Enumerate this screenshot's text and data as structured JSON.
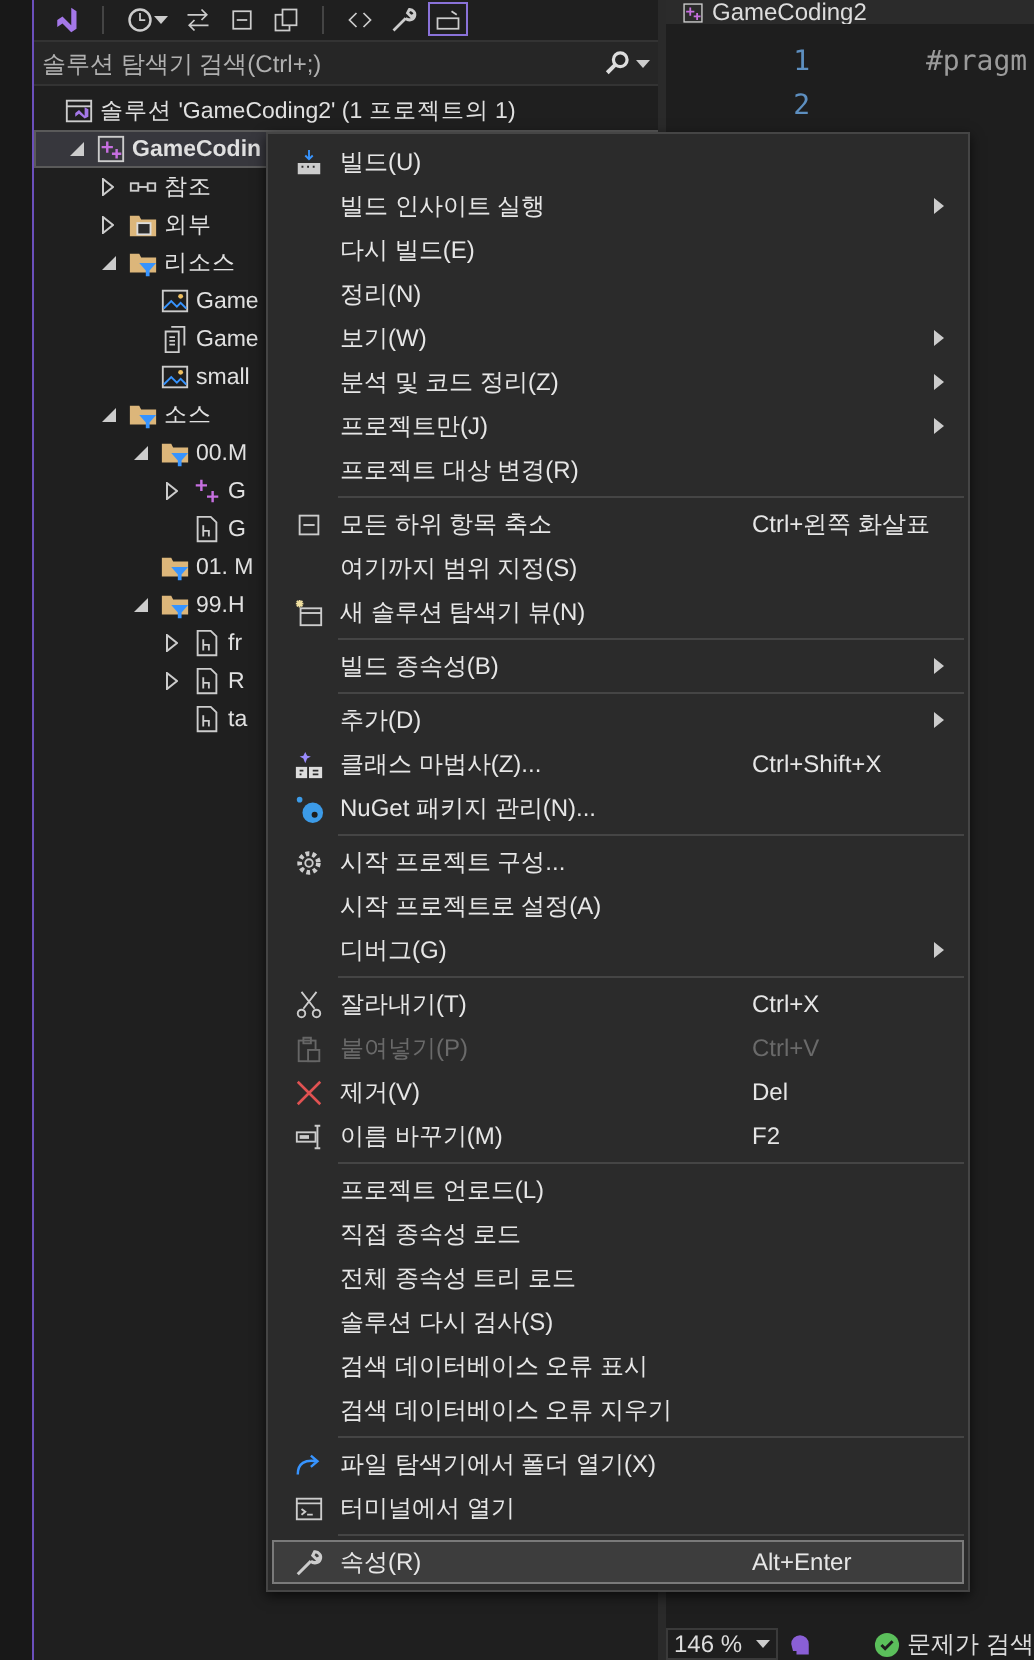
{
  "toolbar": {
    "buttons": [
      {
        "kind": "vs",
        "active": false
      },
      {
        "kind": "history",
        "active": false
      },
      {
        "kind": "sync",
        "active": false
      },
      {
        "kind": "collapse",
        "active": false
      },
      {
        "kind": "copy",
        "active": false
      },
      {
        "kind": "code",
        "active": false
      },
      {
        "kind": "wrench",
        "active": false
      },
      {
        "kind": "preview",
        "active": true
      }
    ]
  },
  "search": {
    "placeholder": "솔루션 탐색기 검색(Ctrl+;)"
  },
  "tree": {
    "label": "솔루션 'GameCoding2' (1 프로젝트의 1)",
    "kind": "solution",
    "selected": false,
    "children": [
      {
        "label": "GameCodin",
        "kind": "project",
        "selected": true,
        "expanded": true,
        "children": [
          {
            "label": "참조",
            "kind": "reference",
            "selected": false,
            "expanded": false
          },
          {
            "label": "외부",
            "kind": "external",
            "selected": false,
            "expanded": false
          },
          {
            "label": "리소스",
            "kind": "filter",
            "selected": false,
            "expanded": true,
            "children": [
              {
                "label": "Game",
                "kind": "image",
                "selected": false
              },
              {
                "label": "Game",
                "kind": "document",
                "selected": false
              },
              {
                "label": "small",
                "kind": "image",
                "selected": false
              }
            ]
          },
          {
            "label": "소스",
            "kind": "filter",
            "selected": false,
            "expanded": true,
            "children": [
              {
                "label": "00.M",
                "kind": "filter",
                "selected": false,
                "expanded": true,
                "children": [
                  {
                    "label": "G",
                    "kind": "cpp",
                    "selected": false,
                    "expanded": false
                  },
                  {
                    "label": "G",
                    "kind": "header",
                    "selected": false
                  }
                ]
              },
              {
                "label": "01. M",
                "kind": "filter",
                "selected": false
              },
              {
                "label": "99.H",
                "kind": "filter",
                "selected": false,
                "expanded": true,
                "children": [
                  {
                    "label": "fr",
                    "kind": "header",
                    "selected": false,
                    "expanded": false
                  },
                  {
                    "label": "R",
                    "kind": "header",
                    "selected": false,
                    "expanded": false
                  },
                  {
                    "label": "ta",
                    "kind": "header",
                    "selected": false
                  }
                ]
              }
            ]
          }
        ]
      }
    ]
  },
  "editor": {
    "tab": "GameCoding2",
    "lines": [
      {
        "number": "1",
        "code": "#pragm"
      },
      {
        "number": "2"
      }
    ]
  },
  "status_bar": {
    "zoom": "146 %",
    "problems": "문제가 검색"
  },
  "menu": {
    "groups": [
      [
        {
          "label": "빌드(U)",
          "kind": "build",
          "submenu": false,
          "disabled": false,
          "highlighted": false
        },
        {
          "label": "빌드 인사이트 실행",
          "submenu": true,
          "disabled": false,
          "highlighted": false
        },
        {
          "label": "다시 빌드(E)",
          "submenu": false,
          "disabled": false,
          "highlighted": false
        },
        {
          "label": "정리(N)",
          "submenu": false,
          "disabled": false,
          "highlighted": false
        },
        {
          "label": "보기(W)",
          "submenu": true,
          "disabled": false,
          "highlighted": false
        },
        {
          "label": "분석 및 코드 정리(Z)",
          "submenu": true,
          "disabled": false,
          "highlighted": false
        },
        {
          "label": "프로젝트만(J)",
          "submenu": true,
          "disabled": false,
          "highlighted": false
        },
        {
          "label": "프로젝트 대상 변경(R)",
          "submenu": false,
          "disabled": false,
          "highlighted": false
        }
      ],
      [
        {
          "label": "모든 하위 항목 축소",
          "kind": "collapse",
          "shortcut": "Ctrl+왼쪽 화살표",
          "submenu": false,
          "disabled": false,
          "highlighted": false
        },
        {
          "label": "여기까지 범위 지정(S)",
          "submenu": false,
          "disabled": false,
          "highlighted": false
        },
        {
          "label": "새 솔루션 탐색기 뷰(N)",
          "kind": "newview",
          "submenu": false,
          "disabled": false,
          "highlighted": false
        }
      ],
      [
        {
          "label": "빌드 종속성(B)",
          "submenu": true,
          "disabled": false,
          "highlighted": false
        }
      ],
      [
        {
          "label": "추가(D)",
          "submenu": true,
          "disabled": false,
          "highlighted": false
        },
        {
          "label": "클래스 마법사(Z)...",
          "kind": "classwizard",
          "shortcut": "Ctrl+Shift+X",
          "submenu": false,
          "disabled": false,
          "highlighted": false
        },
        {
          "label": "NuGet 패키지 관리(N)...",
          "kind": "nuget",
          "submenu": false,
          "disabled": false,
          "highlighted": false
        }
      ],
      [
        {
          "label": "시작 프로젝트 구성...",
          "kind": "gear",
          "submenu": false,
          "disabled": false,
          "highlighted": false
        },
        {
          "label": "시작 프로젝트로 설정(A)",
          "submenu": false,
          "disabled": false,
          "highlighted": false
        },
        {
          "label": "디버그(G)",
          "submenu": true,
          "disabled": false,
          "highlighted": false
        }
      ],
      [
        {
          "label": "잘라내기(T)",
          "kind": "cut",
          "shortcut": "Ctrl+X",
          "submenu": false,
          "disabled": false,
          "highlighted": false
        },
        {
          "label": "붙여넣기(P)",
          "kind": "paste",
          "shortcut": "Ctrl+V",
          "submenu": false,
          "disabled": true,
          "highlighted": false
        },
        {
          "label": "제거(V)",
          "kind": "remove",
          "shortcut": "Del",
          "submenu": false,
          "disabled": false,
          "highlighted": false
        },
        {
          "label": "이름 바꾸기(M)",
          "kind": "rename",
          "shortcut": "F2",
          "submenu": false,
          "disabled": false,
          "highlighted": false
        }
      ],
      [
        {
          "label": "프로젝트 언로드(L)",
          "submenu": false,
          "disabled": false,
          "highlighted": false
        },
        {
          "label": "직접 종속성 로드",
          "submenu": false,
          "disabled": false,
          "highlighted": false
        },
        {
          "label": "전체 종속성 트리 로드",
          "submenu": false,
          "disabled": false,
          "highlighted": false
        },
        {
          "label": "솔루션 다시 검사(S)",
          "submenu": false,
          "disabled": false,
          "highlighted": false
        },
        {
          "label": "검색 데이터베이스 오류 표시",
          "submenu": false,
          "disabled": false,
          "highlighted": false
        },
        {
          "label": "검색 데이터베이스 오류 지우기",
          "submenu": false,
          "disabled": false,
          "highlighted": false
        }
      ],
      [
        {
          "label": "파일 탐색기에서 폴더 열기(X)",
          "kind": "openfolder",
          "submenu": false,
          "disabled": false,
          "highlighted": false
        },
        {
          "label": "터미널에서 열기",
          "kind": "terminal",
          "submenu": false,
          "disabled": false,
          "highlighted": false
        }
      ],
      [
        {
          "label": "속성(R)",
          "kind": "wrench",
          "shortcut": "Alt+Enter",
          "submenu": false,
          "disabled": false,
          "highlighted": true
        }
      ]
    ]
  }
}
